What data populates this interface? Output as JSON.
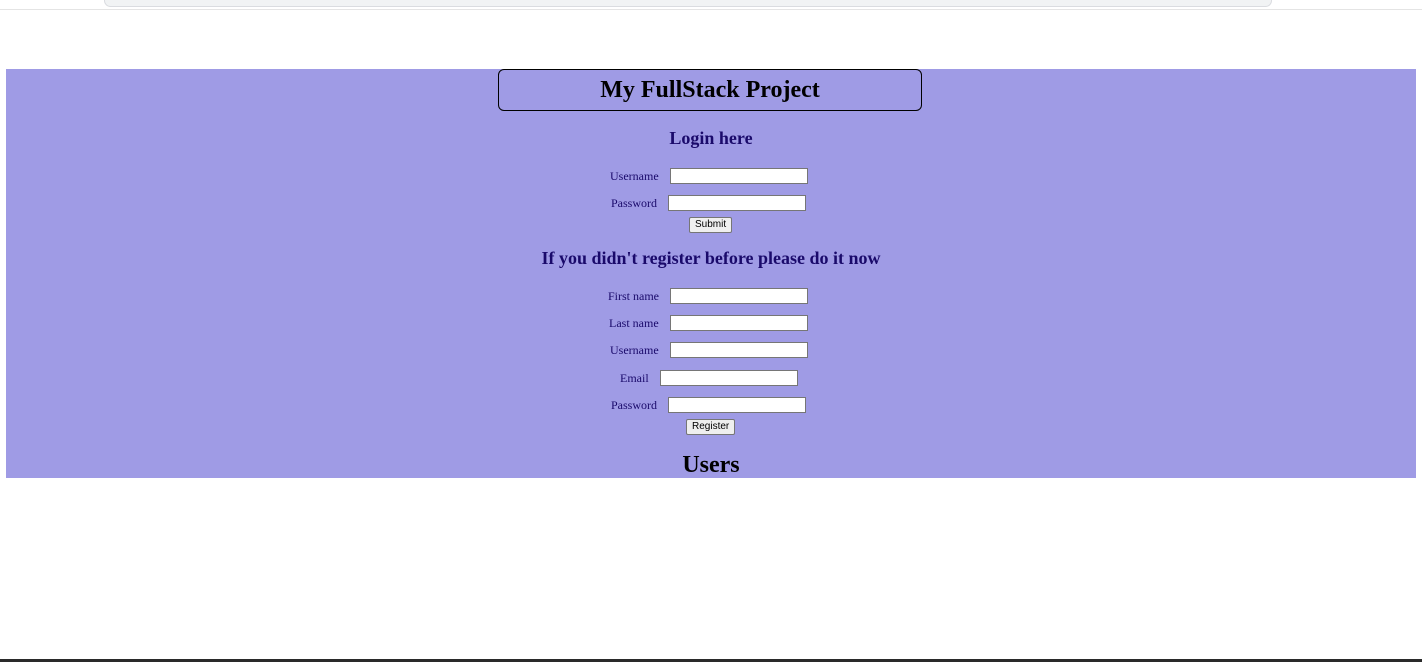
{
  "header": {
    "title": "My FullStack Project"
  },
  "login": {
    "heading": "Login here",
    "fields": [
      {
        "label": "Username",
        "value": ""
      },
      {
        "label": "Password",
        "value": ""
      }
    ],
    "submit_label": "Submit"
  },
  "register": {
    "heading": "If you didn't register before please do it now",
    "fields": [
      {
        "label": "First name",
        "value": ""
      },
      {
        "label": "Last name",
        "value": ""
      },
      {
        "label": "Username",
        "value": ""
      },
      {
        "label": "Email",
        "value": ""
      },
      {
        "label": "Password",
        "value": ""
      }
    ],
    "submit_label": "Register"
  },
  "users": {
    "heading": "Users"
  },
  "colors": {
    "panel_background": "#9f9be5",
    "heading_text": "#1a0a6b"
  }
}
